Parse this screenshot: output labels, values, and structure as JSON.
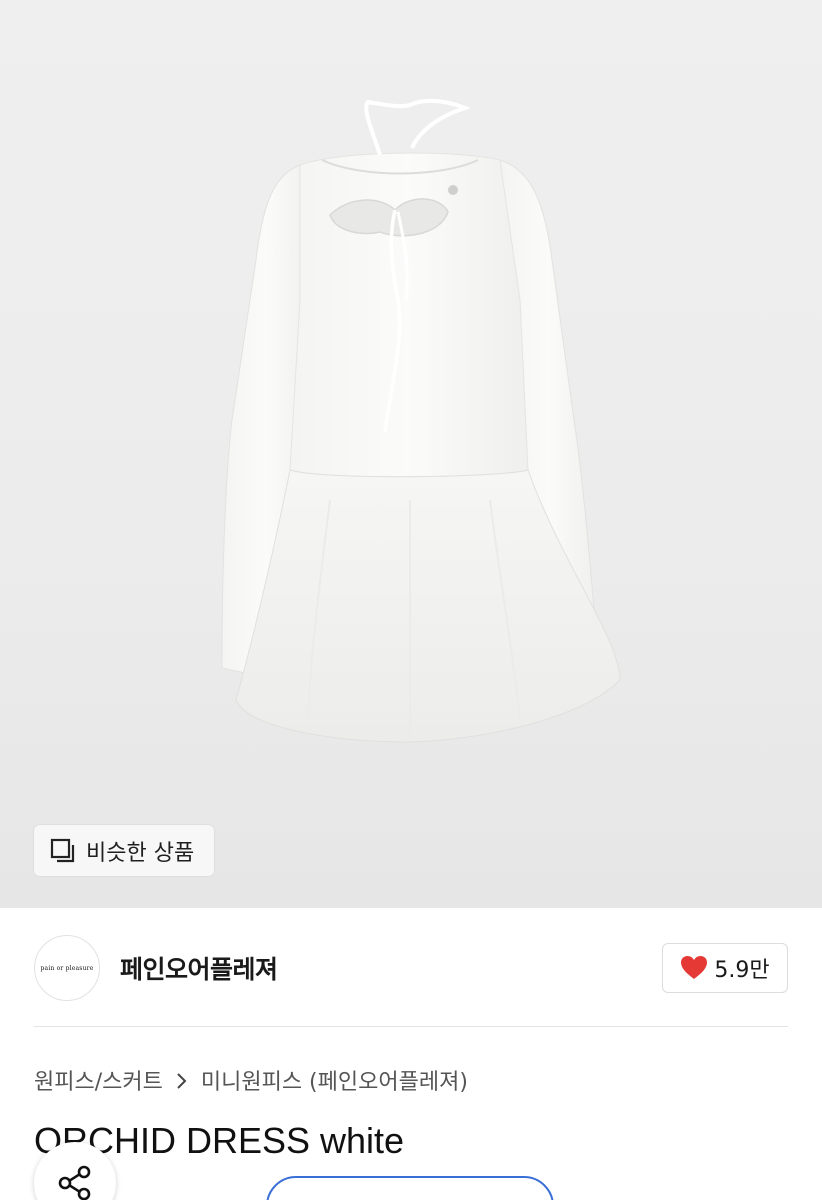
{
  "hero": {
    "image_alt": "",
    "similar_button_label": "비슷한 상품",
    "similar_icon": "stacked-squares-icon"
  },
  "seller": {
    "logo_text": "pain or pleasure",
    "name": "페인오어플레져",
    "like_count": "5.9만",
    "like_icon": "heart-icon",
    "like_color": "#e53935"
  },
  "breadcrumb": {
    "category": "원피스/스커트",
    "subcategory": "미니원피스 (페인오어플레져)"
  },
  "product": {
    "title": "ORCHID DRESS white"
  },
  "floating": {
    "share_icon": "share-icon",
    "cta_label": "",
    "accent": "#3b6fd8"
  }
}
